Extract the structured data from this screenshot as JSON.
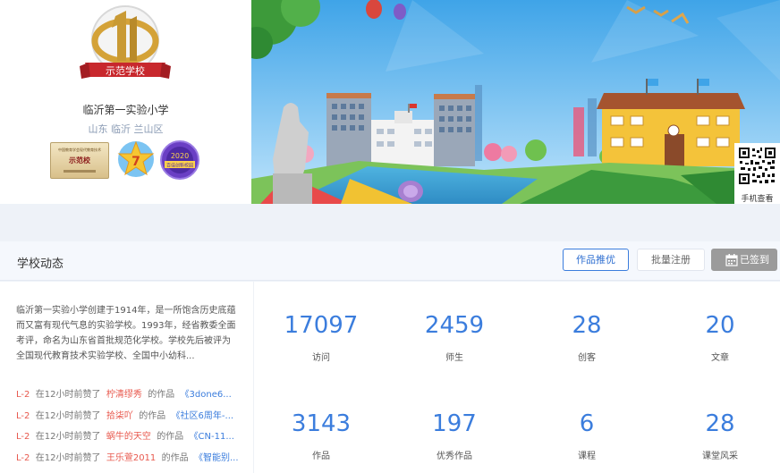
{
  "school": {
    "emblem_text": "示范学校",
    "name": "临沂第一实验小学",
    "region": "山东 临沂 兰山区",
    "badges": {
      "plaque_small_text": "中国教育学会现代教育技术",
      "plaque_main_text": "示范校",
      "star_number": "7",
      "year_badge": "2020",
      "year_badge_caption": "百佳创新校园"
    }
  },
  "qr": {
    "label": "手机查看"
  },
  "section": {
    "title": "学校动态",
    "promote_button": "作品推优",
    "register_button": "批量注册",
    "signed_button": "已签到"
  },
  "intro": "临沂第一实验小学创建于1914年，是一所饱含历史底蕴而又富有现代气息的实验学校。1993年，经省教委全面考评，命名为山东省首批规范化学校。学校先后被评为全国现代教育技术实验学校、全国中小幼科...",
  "feed": [
    {
      "level": "L-2",
      "time": "在12小时前赞了",
      "user": "柠清缪秀",
      "mid": "的作品",
      "work": "《3done6..."
    },
    {
      "level": "L-2",
      "time": "在12小时前赞了",
      "user": "拾柒吖",
      "mid": "的作品",
      "work": "《社区6周年-..."
    },
    {
      "level": "L-2",
      "time": "在12小时前赞了",
      "user": "蜗牛的天空",
      "mid": "的作品",
      "work": "《CN-11..."
    },
    {
      "level": "L-2",
      "time": "在12小时前赞了",
      "user": "王乐萱2011",
      "mid": "的作品",
      "work": "《智能别..."
    }
  ],
  "stats": [
    {
      "value": "17097",
      "label": "访问"
    },
    {
      "value": "2459",
      "label": "师生"
    },
    {
      "value": "28",
      "label": "创客"
    },
    {
      "value": "20",
      "label": "文章"
    },
    {
      "value": "3143",
      "label": "作品"
    },
    {
      "value": "197",
      "label": "优秀作品"
    },
    {
      "value": "6",
      "label": "课程"
    },
    {
      "value": "28",
      "label": "课堂风采"
    }
  ],
  "colors": {
    "accent": "#3b7ddd",
    "feed_user": "#e8584d",
    "signed_bg": "#9b9b9b"
  }
}
